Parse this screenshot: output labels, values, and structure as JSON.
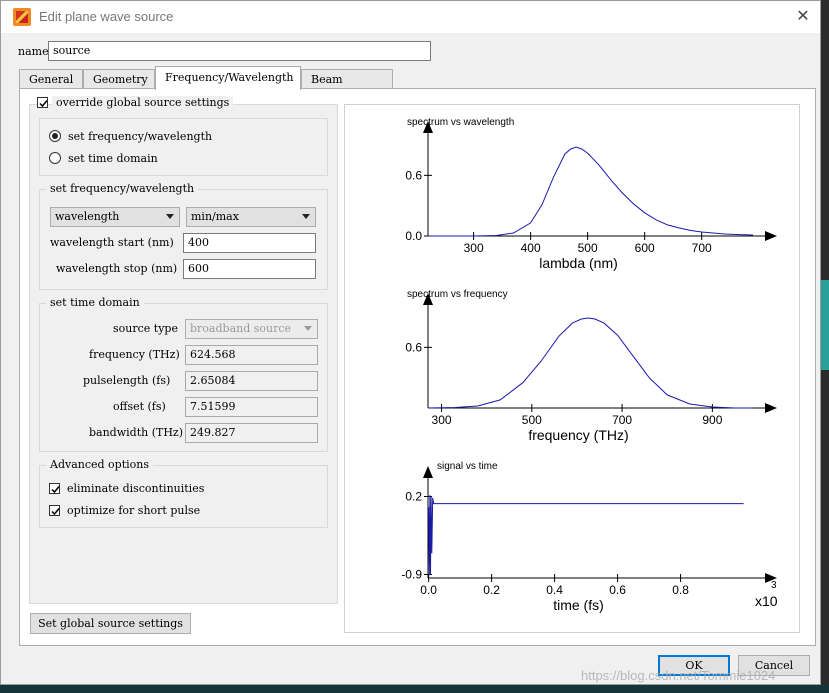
{
  "window": {
    "title": "Edit plane wave source",
    "close_glyph": "✕"
  },
  "name_field": {
    "label": "name",
    "value": "source"
  },
  "tabs": [
    {
      "label": "General",
      "active": false
    },
    {
      "label": "Geometry",
      "active": false
    },
    {
      "label": "Frequency/Wavelength",
      "active": true
    },
    {
      "label": "Beam options",
      "active": false
    }
  ],
  "override": {
    "label": "override global source settings",
    "checked": true
  },
  "mode": {
    "options": [
      {
        "label": "set frequency/wavelength",
        "selected": true
      },
      {
        "label": "set time domain",
        "selected": false
      }
    ]
  },
  "freq_wl": {
    "title": "set frequency/wavelength",
    "type_select": "wavelength",
    "range_select": "min/max",
    "start_label": "wavelength start (nm)",
    "start_value": "400",
    "stop_label": "wavelength stop (nm)",
    "stop_value": "600"
  },
  "time_domain": {
    "title": "set time domain",
    "source_type_label": "source type",
    "source_type_value": "broadband source",
    "fields": [
      {
        "label": "frequency (THz)",
        "value": "624.568"
      },
      {
        "label": "pulselength (fs)",
        "value": "2.65084"
      },
      {
        "label": "offset (fs)",
        "value": "7.51599"
      },
      {
        "label": "bandwidth (THz)",
        "value": "249.827"
      }
    ]
  },
  "advanced": {
    "title": "Advanced options",
    "options": [
      {
        "label": "eliminate discontinuities",
        "checked": true
      },
      {
        "label": "optimize for short pulse",
        "checked": true
      }
    ]
  },
  "buttons": {
    "global": "Set global source settings",
    "ok": "OK",
    "cancel": "Cancel"
  },
  "watermark": "https://blog.csdn.net/Tommie1024",
  "colors": {
    "curve": "#1a1aa8",
    "default_button_border": "#0078d7"
  },
  "chart_data": [
    {
      "type": "line",
      "title": "spectrum vs wavelength",
      "xlabel": "lambda (nm)",
      "ylabel": "",
      "xlim": [
        220,
        790
      ],
      "ylim": [
        0,
        0.92
      ],
      "xticks": [
        300,
        400,
        500,
        600,
        700
      ],
      "yticks": [
        0.0,
        0.6
      ],
      "ytick_labels": [
        "0.0",
        "0.6"
      ],
      "series": [
        {
          "x": [
            220,
            260,
            300,
            340,
            370,
            400,
            420,
            440,
            460,
            470,
            480,
            490,
            500,
            520,
            540,
            560,
            580,
            600,
            620,
            640,
            660,
            680,
            700,
            720,
            740,
            760,
            790
          ],
          "y": [
            0.0,
            0.0,
            0.0,
            0.005,
            0.03,
            0.13,
            0.31,
            0.58,
            0.81,
            0.86,
            0.88,
            0.86,
            0.82,
            0.7,
            0.56,
            0.43,
            0.32,
            0.23,
            0.16,
            0.11,
            0.08,
            0.055,
            0.04,
            0.03,
            0.02,
            0.015,
            0.01
          ]
        }
      ]
    },
    {
      "type": "line",
      "title": "spectrum vs frequency",
      "xlabel": "frequency (THz)",
      "ylabel": "",
      "xlim": [
        270,
        990
      ],
      "ylim": [
        0,
        0.92
      ],
      "xticks": [
        300,
        500,
        700,
        900
      ],
      "yticks": [
        0.6
      ],
      "ytick_labels": [
        "0.6"
      ],
      "series": [
        {
          "x": [
            270,
            330,
            380,
            430,
            480,
            520,
            560,
            590,
            610,
            625,
            640,
            660,
            690,
            720,
            760,
            800,
            850,
            900,
            950,
            990
          ],
          "y": [
            0.0,
            0.005,
            0.02,
            0.08,
            0.25,
            0.46,
            0.71,
            0.84,
            0.88,
            0.89,
            0.88,
            0.84,
            0.72,
            0.54,
            0.3,
            0.13,
            0.04,
            0.01,
            0.0,
            0.0
          ]
        }
      ]
    },
    {
      "type": "line",
      "title": "signal vs time",
      "xlabel": "time (fs)",
      "ylabel": "",
      "x_multiplier": "x10",
      "x_multiplier_exp": "3",
      "xlim": [
        -0.002,
        1.03
      ],
      "ylim": [
        -0.95,
        0.32
      ],
      "xticks": [
        0.0,
        0.2,
        0.4,
        0.6,
        0.8
      ],
      "xtick_labels": [
        "0.0",
        "0.2",
        "0.4",
        "0.6",
        "0.8"
      ],
      "yticks": [
        0.2,
        -0.9
      ],
      "ytick_labels": [
        "0.2",
        "-0.9"
      ],
      "series": [
        {
          "x": [
            0.0,
            0.002,
            0.004,
            0.006,
            0.008,
            0.01,
            0.013,
            0.016,
            0.02,
            0.2,
            0.5,
            0.8,
            1.0
          ],
          "y": [
            0.05,
            -0.9,
            0.22,
            -0.9,
            0.2,
            -0.6,
            0.18,
            0.1,
            0.1,
            0.1,
            0.1,
            0.1,
            0.1
          ]
        }
      ]
    }
  ]
}
